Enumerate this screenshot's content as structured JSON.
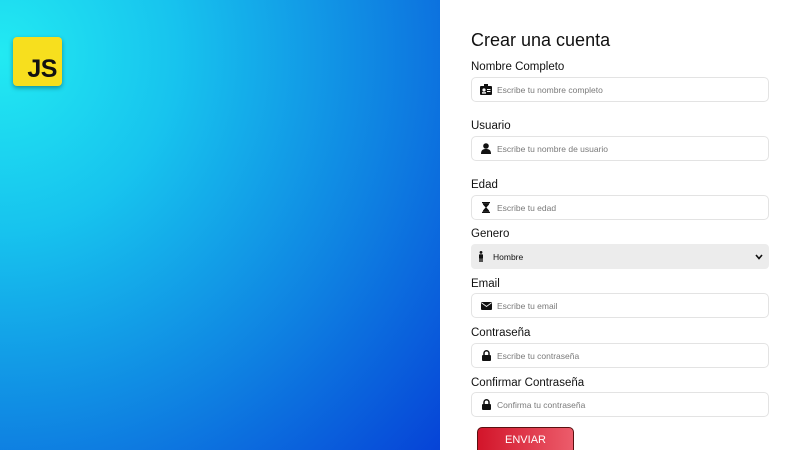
{
  "logo": {
    "text": "JS"
  },
  "form": {
    "title": "Crear una cuenta",
    "fields": [
      {
        "label": "Nombre Completo",
        "placeholder": "Escribe tu nombre completo",
        "icon": "id-card-icon"
      },
      {
        "label": "Usuario",
        "placeholder": "Escribe tu nombre de usuario",
        "icon": "user-icon"
      },
      {
        "label": "Edad",
        "placeholder": "Escribe tu edad",
        "icon": "hourglass-icon"
      }
    ],
    "gender": {
      "label": "Genero",
      "selected": "Hombre",
      "icon": "male-icon"
    },
    "fields2": [
      {
        "label": "Email",
        "placeholder": "Escribe tu email",
        "icon": "envelope-icon"
      },
      {
        "label": "Contraseña",
        "placeholder": "Escribe tu contraseña",
        "icon": "lock-icon"
      },
      {
        "label": "Confirmar Contraseña",
        "placeholder": "Confirma tu contraseña",
        "icon": "lock-icon"
      }
    ],
    "submit_label": "ENVIAR"
  },
  "colors": {
    "gradient_start": "#22eaf2",
    "gradient_end": "#0643d7",
    "logo_bg": "#f7df1e",
    "button_start": "#d2152a",
    "button_end": "#ec5c6b"
  }
}
